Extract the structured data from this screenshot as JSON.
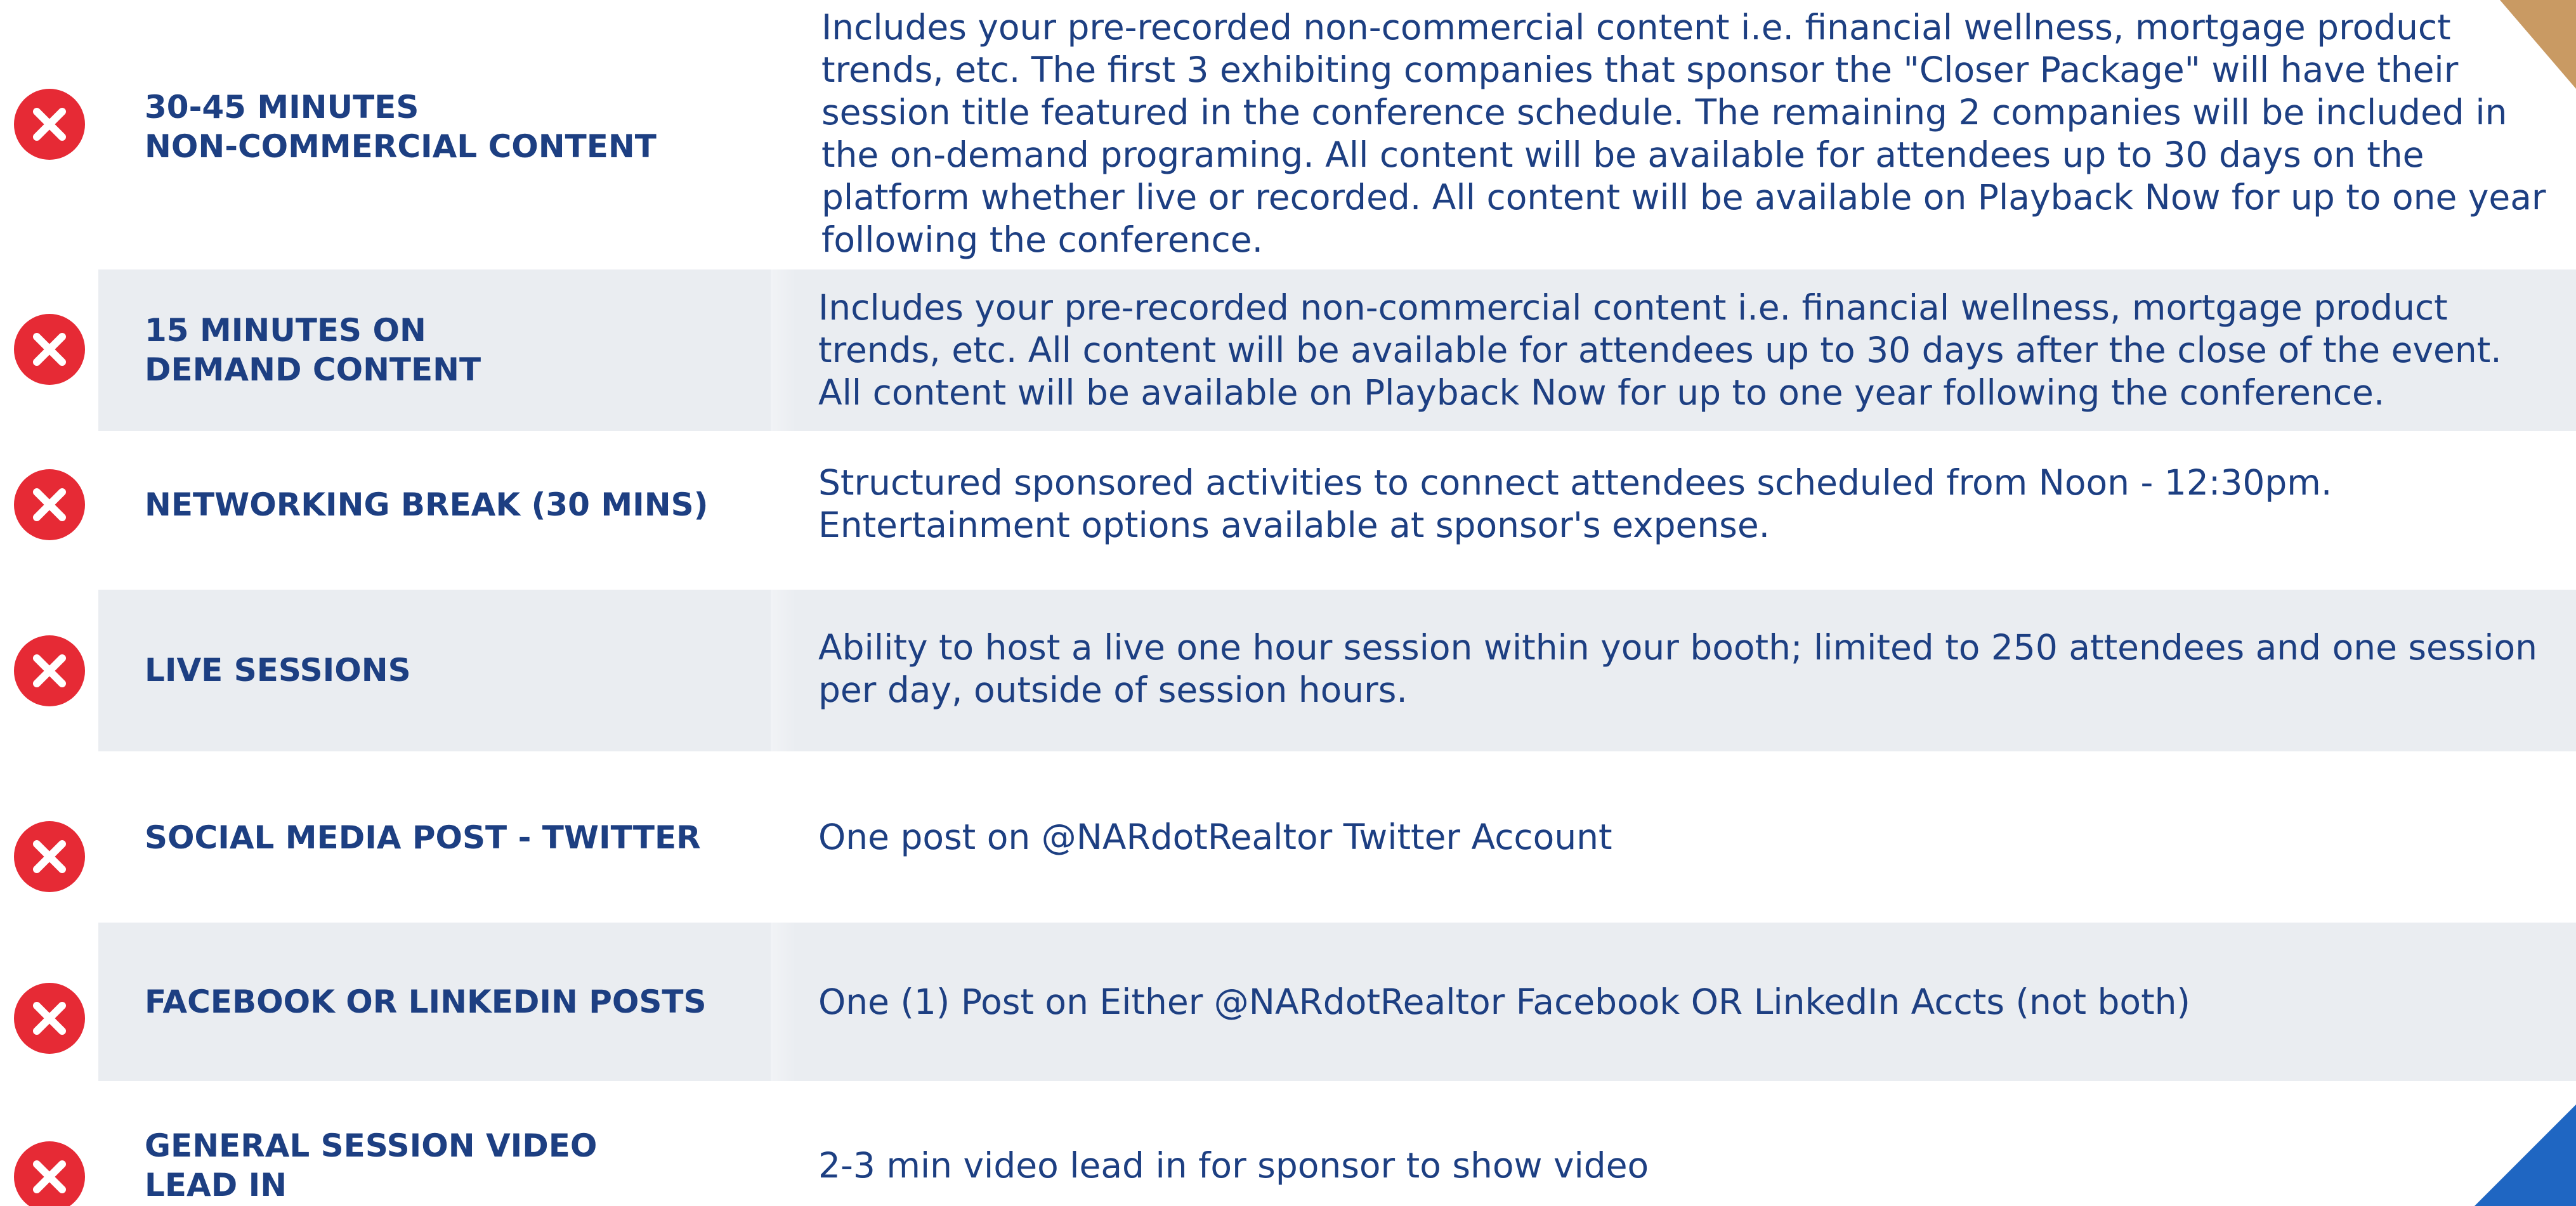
{
  "colors": {
    "heading_blue": "#1d3f82",
    "badge_red": "#e62a35",
    "row_stripe": "#eaedf1",
    "corner_tan": "#c99a63",
    "corner_blue": "#1f66c2"
  },
  "rows": [
    {
      "icon": "close-x-circle-icon",
      "label": "30-45 MINUTES\nNON-COMMERCIAL CONTENT",
      "description": "Includes your pre-recorded non-commercial content i.e. financial wellness, mortgage product trends, etc. The first 3 exhibiting companies that sponsor the \"Closer Package\" will have their session title featured in the conference schedule. The remaining 2 companies will be included in the on-demand programing. All content will be available for attendees up to 30 days on the platform whether live or recorded. All content will be available on Playback Now for up to one year following the conference."
    },
    {
      "icon": "close-x-circle-icon",
      "label": "15 MINUTES ON\nDEMAND CONTENT",
      "description": "Includes your pre-recorded non-commercial content i.e. financial wellness, mortgage product trends, etc. All content will be available for attendees up to 30 days after the close of the event. All content will be available on Playback Now for up to one year following the conference."
    },
    {
      "icon": "close-x-circle-icon",
      "label": "NETWORKING BREAK (30 MINS)",
      "description": "Structured sponsored activities to connect attendees scheduled from Noon - 12:30pm. Entertainment options available at sponsor's expense."
    },
    {
      "icon": "close-x-circle-icon",
      "label": "LIVE SESSIONS",
      "description": "Ability to host a live one hour session within your booth; limited to 250 attendees and one session per day, outside of session hours."
    },
    {
      "icon": "close-x-circle-icon",
      "label": "SOCIAL MEDIA POST - TWITTER",
      "description": "One post on @NARdotRealtor Twitter Account"
    },
    {
      "icon": "close-x-circle-icon",
      "label": "FACEBOOK OR LINKEDIN POSTS",
      "description": "One (1) Post on Either @NARdotRealtor Facebook OR LinkedIn Accts (not both)"
    },
    {
      "icon": "close-x-circle-icon",
      "label": "GENERAL SESSION VIDEO\nLEAD IN",
      "description": "2-3 min video lead in for sponsor to show video"
    }
  ]
}
